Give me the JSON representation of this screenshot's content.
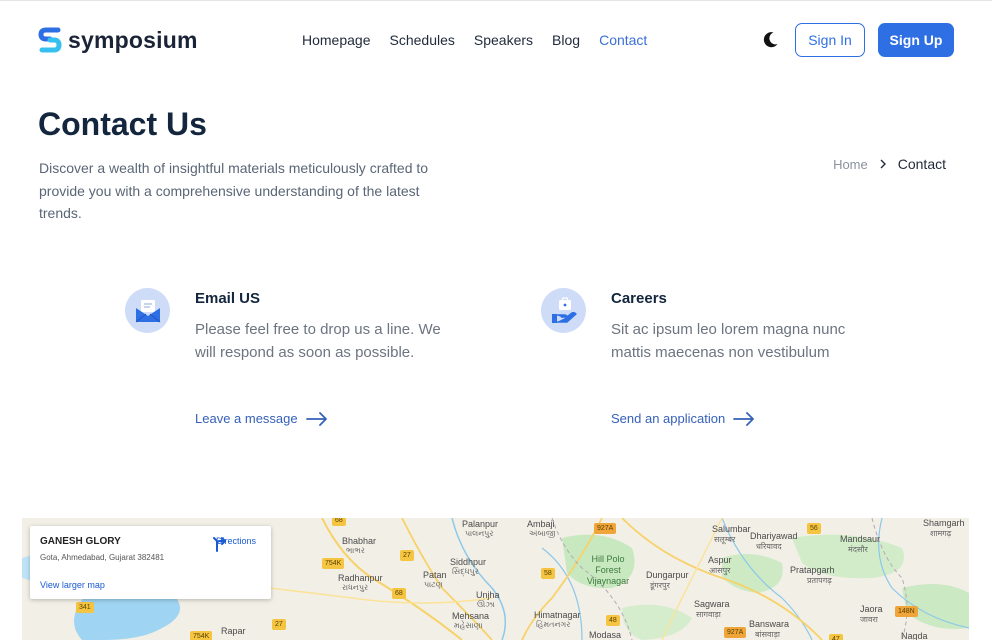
{
  "brand": {
    "name": "symposium",
    "accent": "#2f6fe4",
    "logo_colors": [
      "#2f6fe4",
      "#35c0f0"
    ]
  },
  "nav": {
    "items": [
      {
        "label": "Homepage",
        "active": false
      },
      {
        "label": "Schedules",
        "active": false
      },
      {
        "label": "Speakers",
        "active": false
      },
      {
        "label": "Blog",
        "active": false
      },
      {
        "label": "Contact",
        "active": true
      }
    ],
    "theme_icon": "moon-icon",
    "signin_label": "Sign In",
    "signup_label": "Sign Up"
  },
  "hero": {
    "title": "Contact Us",
    "description": "Discover a wealth of insightful materials meticulously crafted to provide you with a comprehensive understanding of the latest trends.",
    "breadcrumb": {
      "home": "Home",
      "current": "Contact"
    }
  },
  "cards": [
    {
      "icon": "envelope-icon",
      "title": "Email US",
      "body": "Please feel free to drop us a line. We will respond as soon as possible.",
      "link": "Leave a message"
    },
    {
      "icon": "briefcase-hand-icon",
      "title": "Careers",
      "body": "Sit ac ipsum leo lorem magna nunc mattis maecenas non vestibulum",
      "link": "Send an application"
    }
  ],
  "map": {
    "place_name": "GANESH GLORY",
    "address": "Gota, Ahmedabad, Gujarat 382481",
    "directions_label": "Directions",
    "larger_map_label": "View larger map",
    "labels": [
      {
        "text": "Palanpur",
        "sub": "પાલનપુર"
      },
      {
        "text": "Ambaji",
        "sub": "અંબાજી"
      },
      {
        "text": "Bhabhar",
        "sub": "ભાભર"
      },
      {
        "text": "Siddhpur",
        "sub": "સિદ્ધપુર"
      },
      {
        "text": "Radhanpur",
        "sub": "રાધનપુર"
      },
      {
        "text": "Patan",
        "sub": "પાટણ"
      },
      {
        "text": "Unjha",
        "sub": "ઊંઝા"
      },
      {
        "text": "Mehsana",
        "sub": "મહેસાણા"
      },
      {
        "text": "Himatnagar",
        "sub": "હિંમતનગર"
      },
      {
        "text": "Rapar",
        "sub": ""
      },
      {
        "text": "Modasa",
        "sub": ""
      },
      {
        "text": "Hill Polo Forest Vijaynagar",
        "sub": ""
      },
      {
        "text": "Salumbar",
        "sub": "सलूम्बर"
      },
      {
        "text": "Dhariyawad",
        "sub": "धरियावद"
      },
      {
        "text": "Aspur",
        "sub": "आसपुर"
      },
      {
        "text": "Dungarpur",
        "sub": "डूंगरपुर"
      },
      {
        "text": "Sagwara",
        "sub": "सागवाड़ा"
      },
      {
        "text": "Banswara",
        "sub": "बांसवाड़ा"
      },
      {
        "text": "Mandsaur",
        "sub": "मंदसौर"
      },
      {
        "text": "Pratapgarh",
        "sub": "प्रतापगढ़"
      },
      {
        "text": "Shamgarh",
        "sub": "शामगढ़"
      },
      {
        "text": "Jaora",
        "sub": "जावरा"
      },
      {
        "text": "Nagda",
        "sub": ""
      }
    ],
    "shields": [
      "68",
      "927A",
      "56",
      "754K",
      "27",
      "58",
      "341",
      "68",
      "754K",
      "27",
      "48",
      "927A",
      "148N",
      "47"
    ]
  }
}
